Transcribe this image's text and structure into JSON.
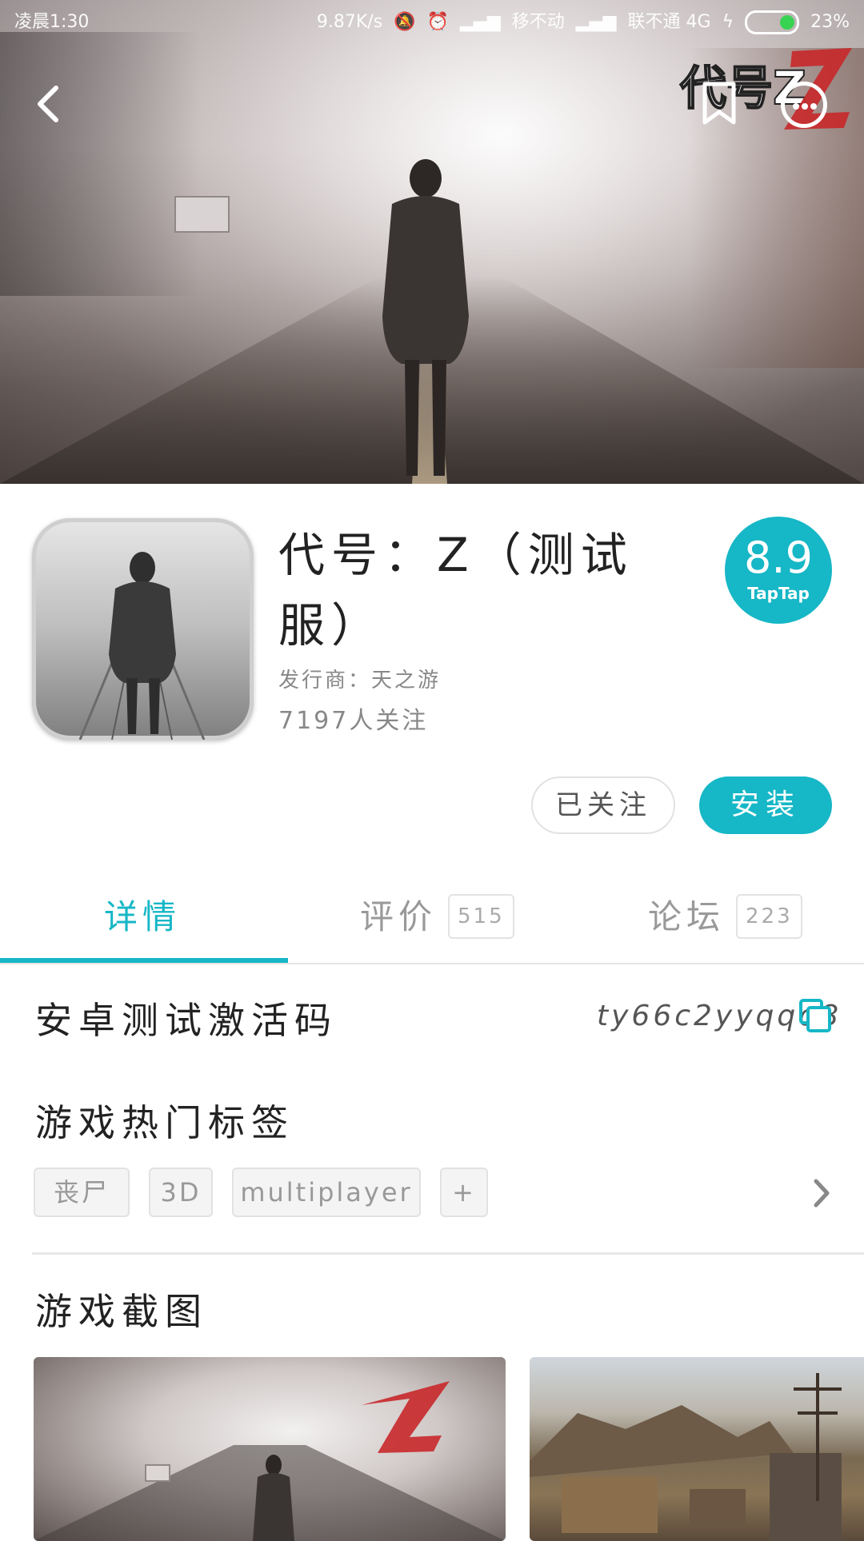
{
  "status_bar": {
    "time": "凌晨1:30",
    "speed": "9.87K/s",
    "carrier1": "移不动",
    "carrier2": "联不通 4G",
    "battery": "23%"
  },
  "app": {
    "title": "代号：Z（测试服）",
    "publisher": "发行商：天之游",
    "followers": "7197人关注",
    "score": "8.9",
    "score_brand": "TapTap",
    "follow_label": "已关注",
    "install_label": "安装",
    "hero_logo_text": "代号Z"
  },
  "tabs": [
    {
      "label": "详情",
      "count": "",
      "active": true
    },
    {
      "label": "评价",
      "count": "515",
      "active": false
    },
    {
      "label": "论坛",
      "count": "223",
      "active": false
    }
  ],
  "activation": {
    "title": "安卓测试激活码",
    "code": "ty66c2yyqqq8"
  },
  "tags_section": {
    "title": "游戏热门标签",
    "tags": [
      "丧尸",
      "3D",
      "multiplayer",
      "+"
    ]
  },
  "screenshots_section": {
    "title": "游戏截图"
  },
  "colors": {
    "accent": "#16b7c6"
  },
  "icons": {
    "back": "chevron-left-icon",
    "bookmark": "bookmark-icon",
    "more": "more-icon",
    "copy": "copy-icon",
    "chevron_right": "chevron-right-icon"
  }
}
